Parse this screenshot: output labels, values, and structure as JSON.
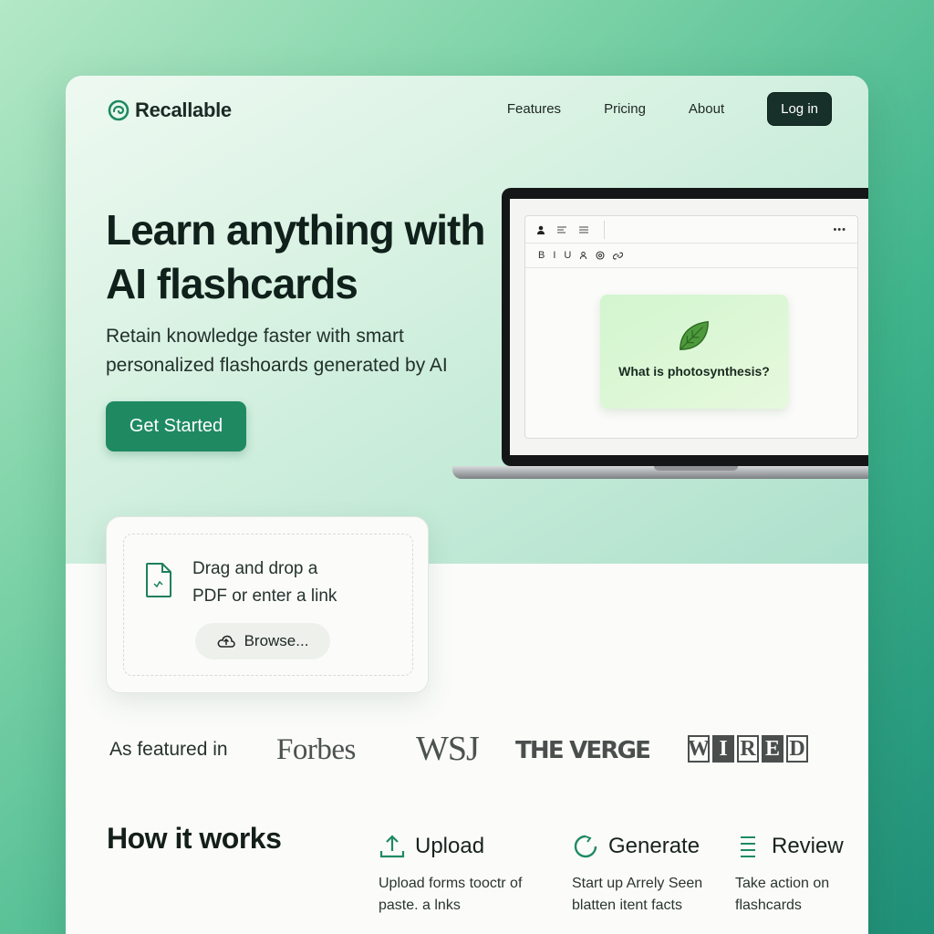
{
  "brand": {
    "name": "Recallable",
    "logo_icon": "brain-icon",
    "accent": "#1f8a62"
  },
  "nav": {
    "links": [
      "Features",
      "Pricing",
      "About"
    ],
    "login_label": "Log in"
  },
  "hero": {
    "title": "Learn anything with AI flashcards",
    "subtitle": "Retain knowledge faster with smart personalized flashoards generated by AI",
    "cta_label": "Get Started"
  },
  "preview": {
    "toolbar_row1": [
      "person-icon",
      "align-icon",
      "list-icon",
      "more-icon"
    ],
    "toolbar_row2": [
      "B",
      "I",
      "U",
      "person-icon",
      "link-icon"
    ],
    "flashcard": {
      "icon": "leaf-icon",
      "question": "What is photosynthesis?"
    }
  },
  "upload": {
    "icon": "file-icon",
    "text_line1": "Drag and drop a",
    "text_line2": "PDF or enter a link",
    "browse_icon": "upload-cloud-icon",
    "browse_label": "Browse..."
  },
  "featured": {
    "label": "As featured in",
    "logos": [
      "Forbes",
      "WSJ",
      "THE VERGE",
      "WIRED"
    ]
  },
  "how": {
    "title": "How it works",
    "steps": [
      {
        "icon": "upload-icon",
        "title": "Upload",
        "desc": "Upload forms tooctr of paste. a lnks"
      },
      {
        "icon": "refresh-icon",
        "title": "Generate",
        "desc": "Start up Arrely Seen blatten itent facts"
      },
      {
        "icon": "list-icon",
        "title": "Review",
        "desc": "Take action on flashcards"
      }
    ]
  }
}
